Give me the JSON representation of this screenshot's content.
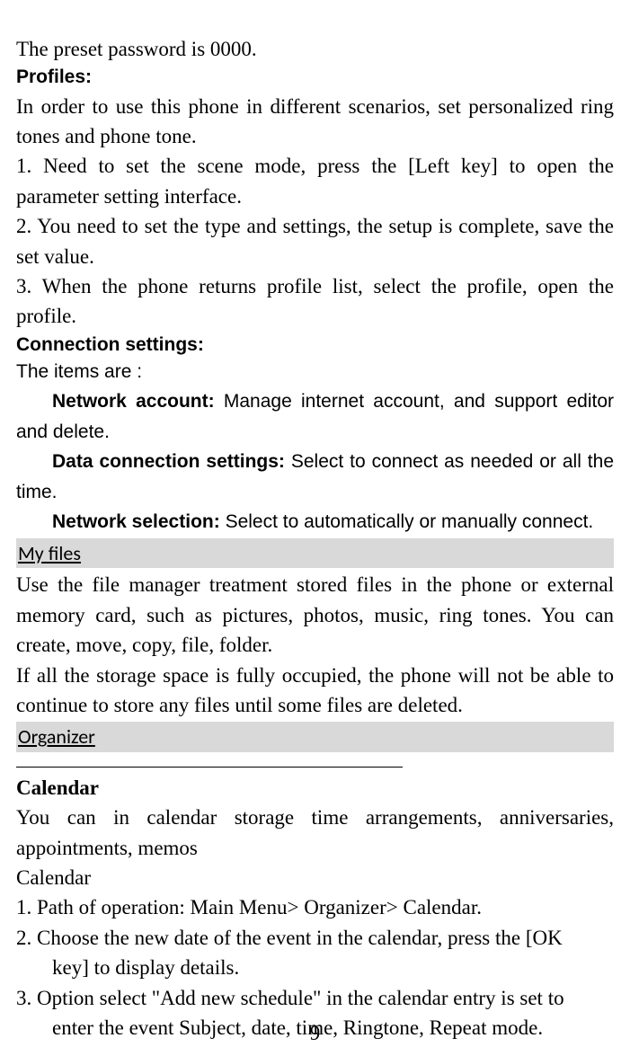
{
  "preset_password": "The preset password is 0000.",
  "profiles_heading": "Profiles:",
  "profiles_intro": "In order to use this phone in different scenarios, set personalized ring tones and phone tone.",
  "profiles_1": "1. Need to set the scene mode, press the [Left key] to open the parameter setting interface.",
  "profiles_2": "2. You need to set the type and settings, the setup is complete, save the set value.",
  "profiles_3": "3. When the phone returns profile list, select the profile, open the profile.",
  "connection_heading": "Connection settings:",
  "connection_intro": "The items are :",
  "network_account_label": "Network account: ",
  "network_account_text": "Manage internet account, and support editor and delete.",
  "data_conn_label": "Data connection settings: ",
  "data_conn_text": "Select to connect as needed or all the time.",
  "network_sel_label": "Network selection: ",
  "network_sel_text": "Select to automatically or manually connect.",
  "myfiles_heading": "My files",
  "myfiles_p1": "Use the file manager treatment stored files in the phone or external memory card, such as pictures, photos, music, ring tones. You can create, move, copy, file, folder.",
  "myfiles_p2": "If all the storage space is fully occupied, the phone will not be able to continue to store any files until some files are deleted.",
  "organizer_heading": "Organizer",
  "calendar_heading": "Calendar",
  "calendar_intro": "You can in calendar storage time arrangements, anniversaries, appointments, memos",
  "calendar_sub": "Calendar",
  "calendar_1": "1. Path of operation: Main Menu> Organizer> Calendar.",
  "calendar_2a": "2. Choose the new date of the event in the calendar, press the [OK",
  "calendar_2b": "key] to display details.",
  "calendar_3a": "3. Option select \"Add new schedule\" in the calendar entry is set to",
  "calendar_3b": "enter the event Subject, date, time, Ringtone, Repeat mode.",
  "page_number": "9"
}
